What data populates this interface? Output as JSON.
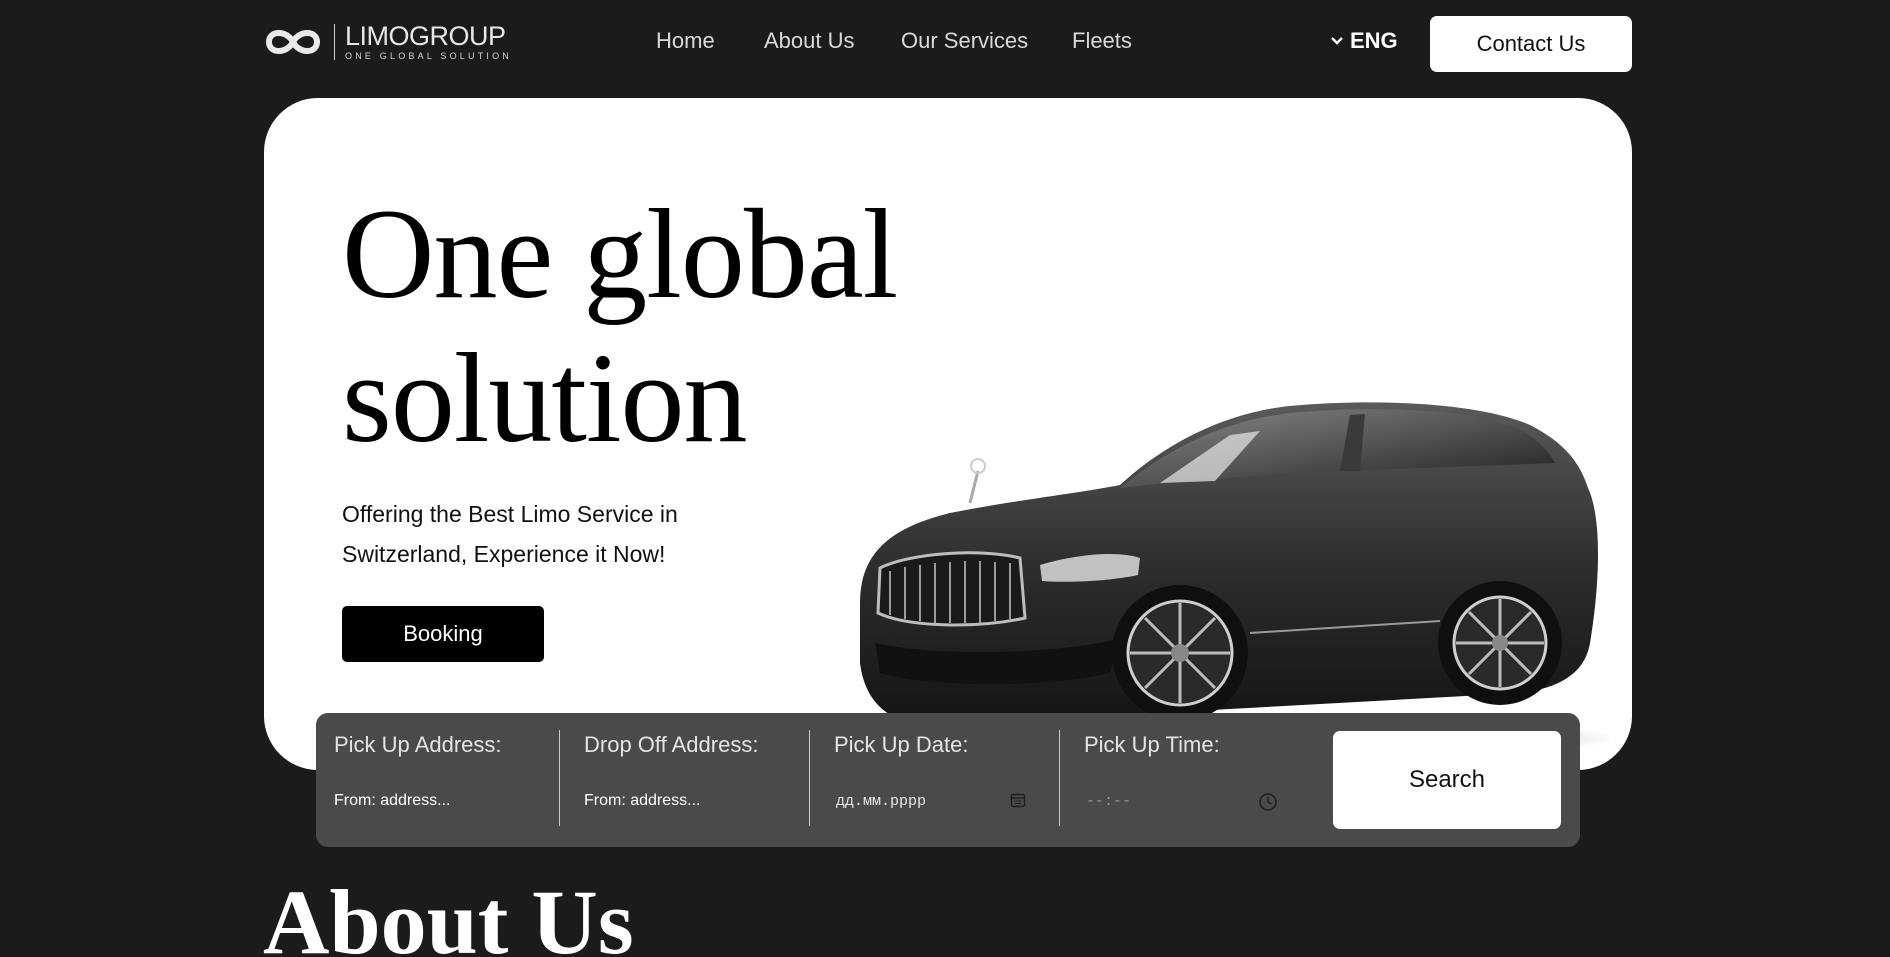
{
  "header": {
    "brand_name": "LIMOGROUP",
    "brand_tagline": "ONE GLOBAL SOLUTION",
    "nav": [
      {
        "label": "Home"
      },
      {
        "label": "About Us"
      },
      {
        "label": "Our Services"
      },
      {
        "label": "Fleets"
      }
    ],
    "language": "ENG",
    "contact_label": "Contact Us"
  },
  "hero": {
    "title_line1": "One global",
    "title_line2": "solution",
    "subtitle_line1": "Offering the Best Limo Service in",
    "subtitle_line2": "Switzerland, Experience it Now!",
    "booking_label": "Booking"
  },
  "search": {
    "pickup_address_label": "Pick Up Address:",
    "pickup_address_placeholder": "From: address...",
    "dropoff_address_label": "Drop Off Address:",
    "dropoff_address_placeholder": "From: address...",
    "pickup_date_label": "Pick Up Date:",
    "pickup_date_placeholder": "дд.мм.рррр",
    "pickup_time_label": "Pick Up Time:",
    "pickup_time_placeholder": "--:--",
    "search_label": "Search"
  },
  "about": {
    "title": "About Us"
  },
  "colors": {
    "page_background": "#1b1b1b",
    "hero_background": "#ffffff",
    "search_bar_background": "#4a4a4a"
  },
  "icons": [
    "infinity-logo-icon",
    "chevron-down-icon",
    "calendar-icon",
    "clock-icon"
  ]
}
